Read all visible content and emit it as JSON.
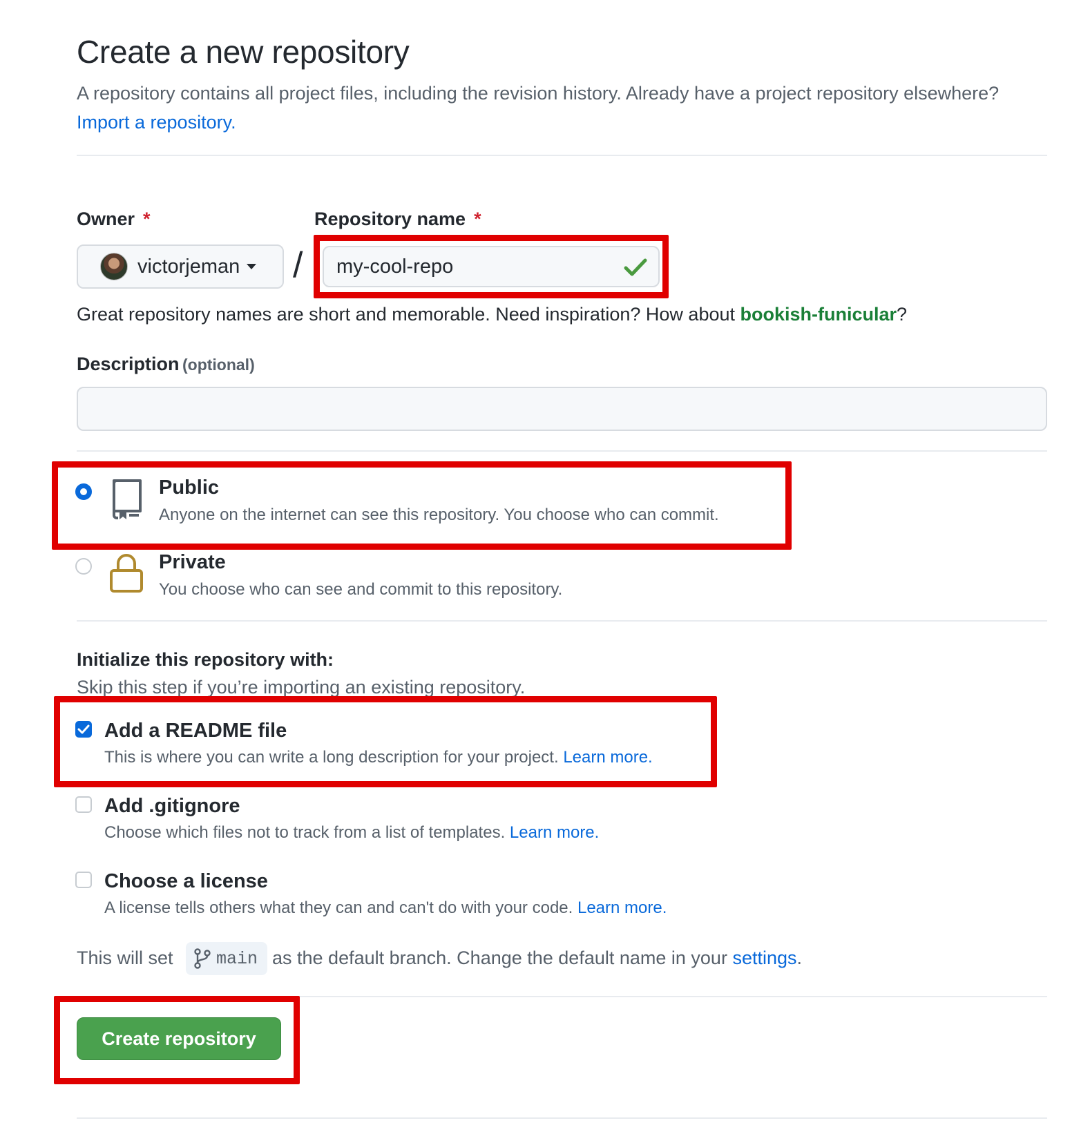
{
  "header": {
    "title": "Create a new repository",
    "subtitle": "A repository contains all project files, including the revision history. Already have a project repository elsewhere?",
    "import_link": "Import a repository."
  },
  "owner": {
    "label": "Owner",
    "required_mark": "*",
    "value": "victorjeman",
    "avatar_icon": "user-avatar"
  },
  "repo_name": {
    "label": "Repository name",
    "required_mark": "*",
    "value": "my-cool-repo",
    "valid_icon": "check-icon",
    "separator": "/"
  },
  "name_hint": {
    "text": "Great repository names are short and memorable. Need inspiration? How about",
    "suggestion": "bookish-funicular",
    "end": "?"
  },
  "description": {
    "label": "Description",
    "optional": "(optional)",
    "value": ""
  },
  "visibility": {
    "selected": "public",
    "options": [
      {
        "id": "public",
        "title": "Public",
        "desc": "Anyone on the internet can see this repository. You choose who can commit.",
        "icon": "repo-book-icon"
      },
      {
        "id": "private",
        "title": "Private",
        "desc": "You choose who can see and commit to this repository.",
        "icon": "lock-icon"
      }
    ]
  },
  "initialize": {
    "heading": "Initialize this repository with:",
    "subheading": "Skip this step if you’re importing an existing repository.",
    "options": [
      {
        "title": "Add a README file",
        "desc": "This is where you can write a long description for your project.",
        "link": "Learn more.",
        "checked": true
      },
      {
        "title": "Add .gitignore",
        "desc": "Choose which files not to track from a list of templates.",
        "link": "Learn more.",
        "checked": false
      },
      {
        "title": "Choose a license",
        "desc": "A license tells others what they can and can't do with your code.",
        "link": "Learn more.",
        "checked": false
      }
    ]
  },
  "branch_note": {
    "prefix": "This will set",
    "branch": "main",
    "branch_icon": "git-branch-icon",
    "middle": "as the default branch. Change the default name in your",
    "link": "settings",
    "end": "."
  },
  "submit": {
    "label": "Create repository"
  },
  "colors": {
    "accent": "#0969da",
    "success": "#1a7f37",
    "button_green": "#4aa14e",
    "highlight_red": "#e00000",
    "lock_gold": "#b08a2e"
  }
}
